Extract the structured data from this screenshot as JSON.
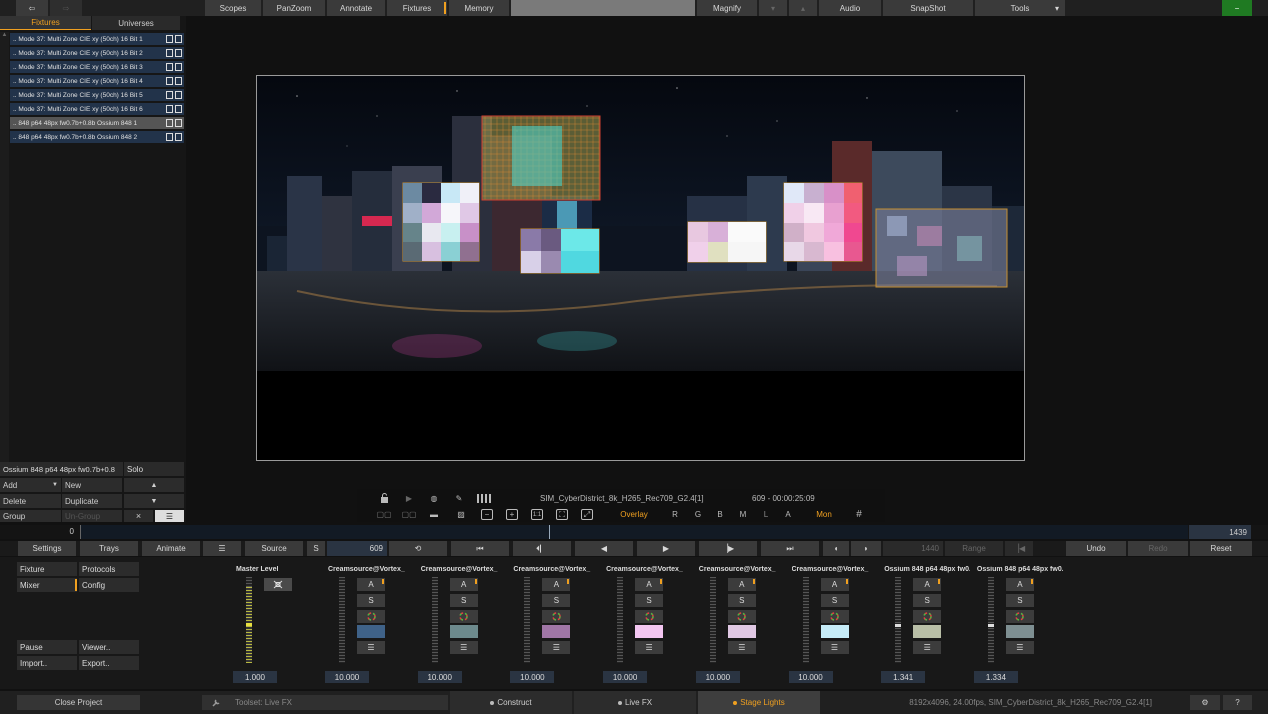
{
  "topbar": {
    "back": "⇦",
    "forward": "⇨",
    "items": [
      "Scopes",
      "PanZoom",
      "Annotate",
      "Fixtures",
      "Memory",
      "Magnify",
      "Audio",
      "SnapShot",
      "Tools"
    ],
    "tools_arrow": "▾",
    "minus": "−"
  },
  "fixtures_panel": {
    "tabs": [
      "Fixtures",
      "Universes"
    ],
    "rows": [
      ".. Mode 37: Multi Zone CIE xy (50ch) 16 Bit 1",
      ".. Mode 37: Multi Zone CIE xy (50ch) 16 Bit 2",
      ".. Mode 37: Multi Zone CIE xy (50ch) 16 Bit 3",
      ".. Mode 37: Multi Zone CIE xy (50ch) 16 Bit 4",
      ".. Mode 37: Multi Zone CIE xy (50ch) 16 Bit 5",
      ".. Mode 37: Multi Zone CIE xy (50ch) 16 Bit 6",
      ".. 848 p64 48px fw0.7b+0.8b  Ossium 848 1",
      ".. 848 p64 48px fw0.7b+0.8b  Ossium 848 2"
    ],
    "selected_fixture": "Ossium 848 p64 48px fw0.7b+0.8",
    "solo": "Solo",
    "add": "Add",
    "new": "New",
    "delete": "Delete",
    "duplicate": "Duplicate",
    "group": "Group",
    "ungroup": "Un-Group",
    "up_arrow": "▲",
    "down_arrow": "▼",
    "close": "×",
    "menu": "☰"
  },
  "viewer_toolbar": {
    "clip_name": "SIM_CyberDistrict_8k_H265_Rec709_G2.4[1]",
    "frame_time": "609  -  00:00:25:09",
    "overlay": "Overlay",
    "channels": [
      "R",
      "G",
      "B",
      "M",
      "L",
      "A"
    ],
    "mon": "Mon",
    "ratio": "1:1",
    "grid": "#"
  },
  "timeline": {
    "start": "0",
    "end": "1439"
  },
  "transport": {
    "settings": "Settings",
    "trays": "Trays",
    "animate": "Animate",
    "menu": "☰",
    "source": "Source",
    "s": "S",
    "frame": "609",
    "loop": "⟲",
    "total": "1440",
    "range": "Range",
    "undo": "Undo",
    "redo": "Redo",
    "reset": "Reset"
  },
  "mixer": {
    "left_buttons": [
      "Fixture",
      "Protocols",
      "Mixer",
      "Config",
      "Pause",
      "Viewer..",
      "Import..",
      "Export.."
    ],
    "master_label": "Master Level",
    "master_value": "1.000",
    "strip_buttons": [
      "A",
      "S",
      "☰"
    ],
    "strips": [
      {
        "title": "Creamsource@Vortex_",
        "color": "#3f6288",
        "value": "10.000"
      },
      {
        "title": "Creamsource@Vortex_",
        "color": "#6d8a8d",
        "value": "10.000"
      },
      {
        "title": "Creamsource@Vortex_",
        "color": "#a076a6",
        "value": "10.000"
      },
      {
        "title": "Creamsource@Vortex_",
        "color": "#f3c6f1",
        "value": "10.000"
      },
      {
        "title": "Creamsource@Vortex_",
        "color": "#e0c8e4",
        "value": "10.000"
      },
      {
        "title": "Creamsource@Vortex_",
        "color": "#c6ecf8",
        "value": "10.000"
      },
      {
        "title": "Ossium 848 p64 48px fw0..",
        "color": "#b8bea6",
        "value": "1.341"
      },
      {
        "title": "Ossium 848 p64 48px fw0..",
        "color": "#7e8f92",
        "value": "1.334"
      }
    ]
  },
  "bottombar": {
    "close_project": "Close Project",
    "toolset": "Toolset: Live FX",
    "tabs": [
      "Construct",
      "Live FX",
      "Stage Lights"
    ],
    "status": "8192x4096, 24.00fps, SIM_CyberDistrict_8k_H265_Rec709_G2.4[1]",
    "help": "?"
  }
}
